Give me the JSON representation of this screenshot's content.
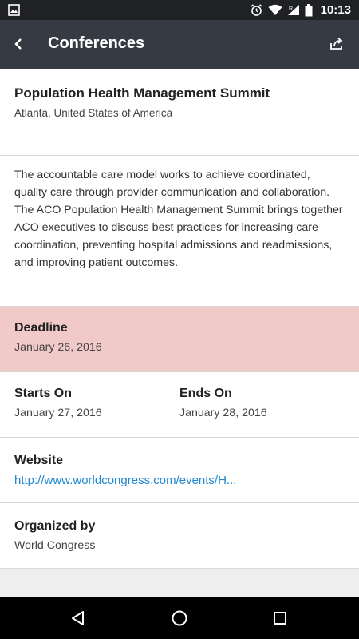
{
  "status_bar": {
    "time": "10:13",
    "icons": [
      "image-icon",
      "alarm-icon",
      "wifi-icon",
      "signal-icon",
      "battery-icon"
    ]
  },
  "app_bar": {
    "title": "Conferences",
    "back_icon": "back-arrow-icon",
    "share_icon": "share-icon"
  },
  "conference": {
    "title": "Population Health Management Summit",
    "location": "Atlanta, United States of America",
    "description": "The accountable care model works to achieve coordinated, quality care through provider communication and collaboration. The ACO Population Health Management Summit brings together ACO executives to discuss best practices for increasing care coordination, preventing hospital admissions and readmissions, and improving patient outcomes.",
    "deadline": {
      "label": "Deadline",
      "value": "January 26, 2016"
    },
    "starts_on": {
      "label": "Starts On",
      "value": "January 27, 2016"
    },
    "ends_on": {
      "label": "Ends On",
      "value": "January 28, 2016"
    },
    "website": {
      "label": "Website",
      "value": "http://www.worldcongress.com/events/H..."
    },
    "organized_by": {
      "label": "Organized by",
      "value": "World Congress"
    }
  },
  "colors": {
    "status_bar": "#1f2124",
    "app_bar": "#363a42",
    "deadline_bg": "#f2c9c9",
    "link": "#1e88d0"
  },
  "nav_bar": {
    "icons": [
      "nav-back-icon",
      "nav-home-icon",
      "nav-recents-icon"
    ]
  }
}
